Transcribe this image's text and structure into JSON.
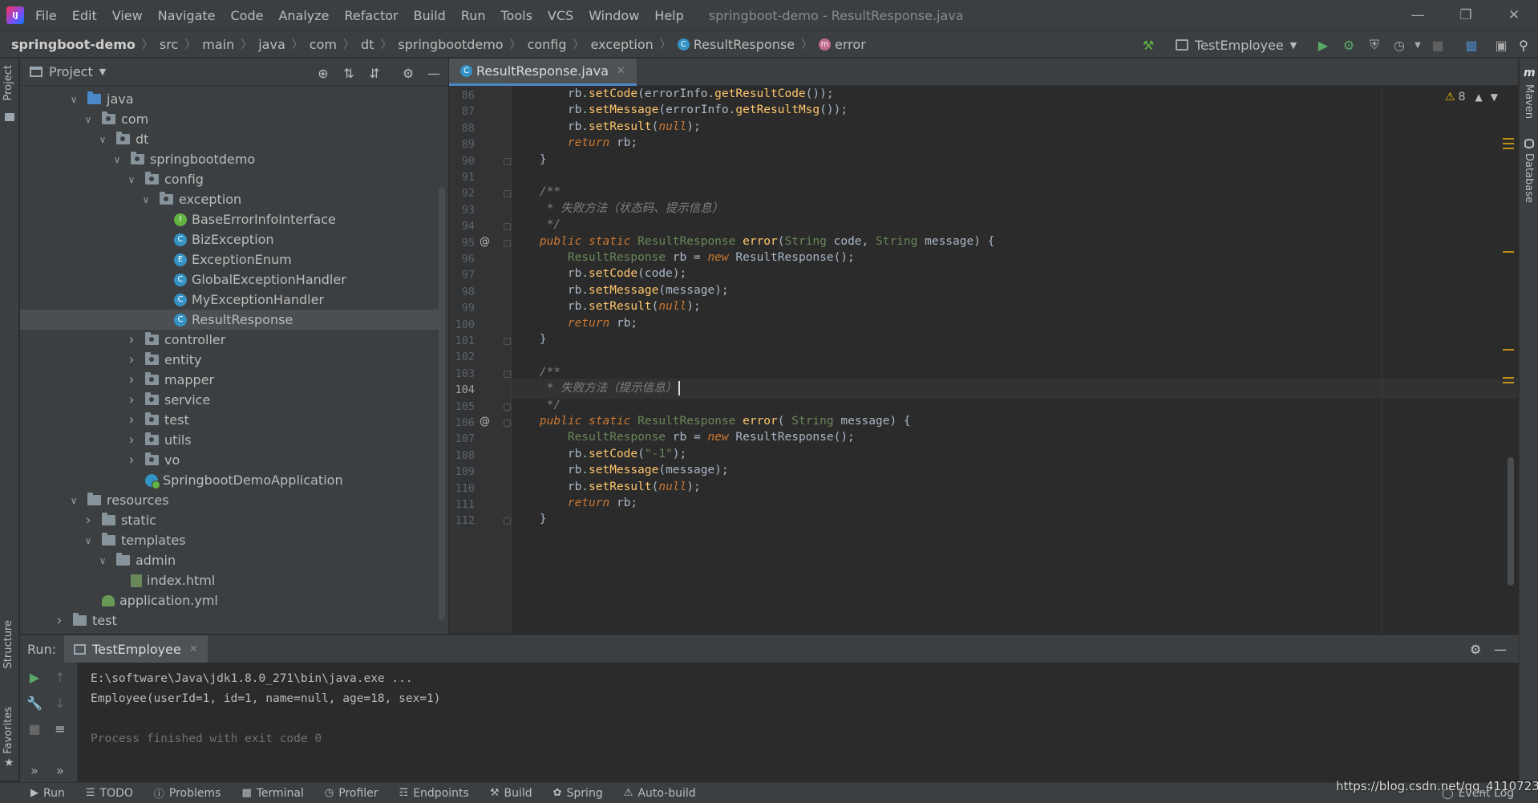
{
  "menubar": {
    "items": [
      "File",
      "Edit",
      "View",
      "Navigate",
      "Code",
      "Analyze",
      "Refactor",
      "Build",
      "Run",
      "Tools",
      "VCS",
      "Window",
      "Help"
    ],
    "window_title": "springboot-demo - ResultResponse.java",
    "logo_text": "IJ"
  },
  "navbar": {
    "crumbs": [
      "springboot-demo",
      "src",
      "main",
      "java",
      "com",
      "dt",
      "springbootdemo",
      "config",
      "exception",
      "ResultResponse",
      "error"
    ],
    "run_config": "TestEmployee"
  },
  "side": {
    "project": "Project",
    "structure": "Structure",
    "favorites": "Favorites",
    "maven": "Maven",
    "database": "Database"
  },
  "project_panel": {
    "title": "Project",
    "tree": [
      {
        "label": "java",
        "kind": "folder-blue",
        "expanded": true
      },
      {
        "label": "com",
        "kind": "package",
        "expanded": true
      },
      {
        "label": "dt",
        "kind": "package",
        "expanded": true
      },
      {
        "label": "springbootdemo",
        "kind": "package",
        "expanded": true
      },
      {
        "label": "config",
        "kind": "package",
        "expanded": true
      },
      {
        "label": "exception",
        "kind": "package",
        "expanded": true
      },
      {
        "label": "BaseErrorInfoInterface",
        "kind": "interface"
      },
      {
        "label": "BizException",
        "kind": "class"
      },
      {
        "label": "ExceptionEnum",
        "kind": "enum"
      },
      {
        "label": "GlobalExceptionHandler",
        "kind": "class"
      },
      {
        "label": "MyExceptionHandler",
        "kind": "class"
      },
      {
        "label": "ResultResponse",
        "kind": "class",
        "selected": true
      },
      {
        "label": "controller",
        "kind": "package",
        "expanded": false
      },
      {
        "label": "entity",
        "kind": "package",
        "expanded": false
      },
      {
        "label": "mapper",
        "kind": "package",
        "expanded": false
      },
      {
        "label": "service",
        "kind": "package",
        "expanded": false
      },
      {
        "label": "test",
        "kind": "package",
        "expanded": false
      },
      {
        "label": "utils",
        "kind": "package",
        "expanded": false
      },
      {
        "label": "vo",
        "kind": "package",
        "expanded": false
      },
      {
        "label": "SpringbootDemoApplication",
        "kind": "spring-class"
      },
      {
        "label": "resources",
        "kind": "folder",
        "expanded": true
      },
      {
        "label": "static",
        "kind": "folder",
        "expanded": false
      },
      {
        "label": "templates",
        "kind": "folder",
        "expanded": true
      },
      {
        "label": "admin",
        "kind": "folder",
        "expanded": true
      },
      {
        "label": "index.html",
        "kind": "html"
      },
      {
        "label": "application.yml",
        "kind": "yml"
      },
      {
        "label": "test",
        "kind": "folder",
        "expanded": false
      }
    ]
  },
  "editor": {
    "tab_label": "ResultResponse.java",
    "warnings_count": "8",
    "current_line": 104,
    "lines": [
      {
        "n": "86",
        "html": "        rb.<span class='fn'>setCode</span>(errorInfo.<span class='fn'>getResultCode</span>());"
      },
      {
        "n": "87",
        "html": "        rb.<span class='fn'>setMessage</span>(errorInfo.<span class='fn'>getResultMsg</span>());"
      },
      {
        "n": "88",
        "html": "        rb.<span class='fn'>setResult</span>(<span class='kw'>null</span>);"
      },
      {
        "n": "89",
        "html": "        <span class='kw'>return</span> rb;"
      },
      {
        "n": "90",
        "html": "    }"
      },
      {
        "n": "91",
        "html": ""
      },
      {
        "n": "92",
        "html": "    <span class='cmz'>/**</span>"
      },
      {
        "n": "93",
        "html": "<span class='cmz'>     * 失败方法（状态码、提示信息）</span>"
      },
      {
        "n": "94",
        "html": "<span class='cmz'>     */</span>"
      },
      {
        "n": "95",
        "html": "    <span class='kw'>public static</span> <span class='st'>ResultResponse</span> <span class='fn'>error</span>(<span class='st'>String</span> code, <span class='st'>String</span> message) {"
      },
      {
        "n": "96",
        "html": "        <span class='st'>ResultResponse</span> rb = <span class='kw'>new</span> ResultResponse();"
      },
      {
        "n": "97",
        "html": "        rb.<span class='fn'>setCode</span>(code);"
      },
      {
        "n": "98",
        "html": "        rb.<span class='fn'>setMessage</span>(message);"
      },
      {
        "n": "99",
        "html": "        rb.<span class='fn'>setResult</span>(<span class='kw'>null</span>);"
      },
      {
        "n": "100",
        "html": "        <span class='kw'>return</span> rb;"
      },
      {
        "n": "101",
        "html": "    }"
      },
      {
        "n": "102",
        "html": ""
      },
      {
        "n": "103",
        "html": "    <span class='cmz'>/**</span>"
      },
      {
        "n": "104",
        "html": "<span class='cmz'>     * 失败方法（提示信息）</span>"
      },
      {
        "n": "105",
        "html": "<span class='cmz'>     */</span>"
      },
      {
        "n": "106",
        "html": "    <span class='kw'>public static</span> <span class='st'>ResultResponse</span> <span class='fn'>error</span>( <span class='st'>String</span> message) {"
      },
      {
        "n": "107",
        "html": "        <span class='st'>ResultResponse</span> rb = <span class='kw'>new</span> ResultResponse();"
      },
      {
        "n": "108",
        "html": "        rb.<span class='fn'>setCode</span>(<span class='st'>\"-1\"</span>);"
      },
      {
        "n": "109",
        "html": "        rb.<span class='fn'>setMessage</span>(message);"
      },
      {
        "n": "110",
        "html": "        rb.<span class='fn'>setResult</span>(<span class='kw'>null</span>);"
      },
      {
        "n": "111",
        "html": "        <span class='kw'>return</span> rb;"
      },
      {
        "n": "112",
        "html": "    }"
      }
    ]
  },
  "run_panel": {
    "label": "Run:",
    "tab": "TestEmployee",
    "console": [
      "E:\\software\\Java\\jdk1.8.0_271\\bin\\java.exe ...",
      "Employee(userId=1, id=1, name=null, age=18, sex=1)",
      "",
      "Process finished with exit code 0"
    ]
  },
  "bottombar": {
    "items": [
      "Run",
      "TODO",
      "Problems",
      "Terminal",
      "Profiler",
      "Endpoints",
      "Build",
      "Spring",
      "Auto-build"
    ],
    "event_log": "Event Log",
    "watermark": "https://blog.csdn.net/qq_41107231"
  },
  "colors": {
    "bg": "#2b2b2b",
    "panel": "#3c3f41",
    "keyword": "#cc7832",
    "method": "#ffc66d",
    "comment": "#808080",
    "accent": "#4a88c7"
  }
}
